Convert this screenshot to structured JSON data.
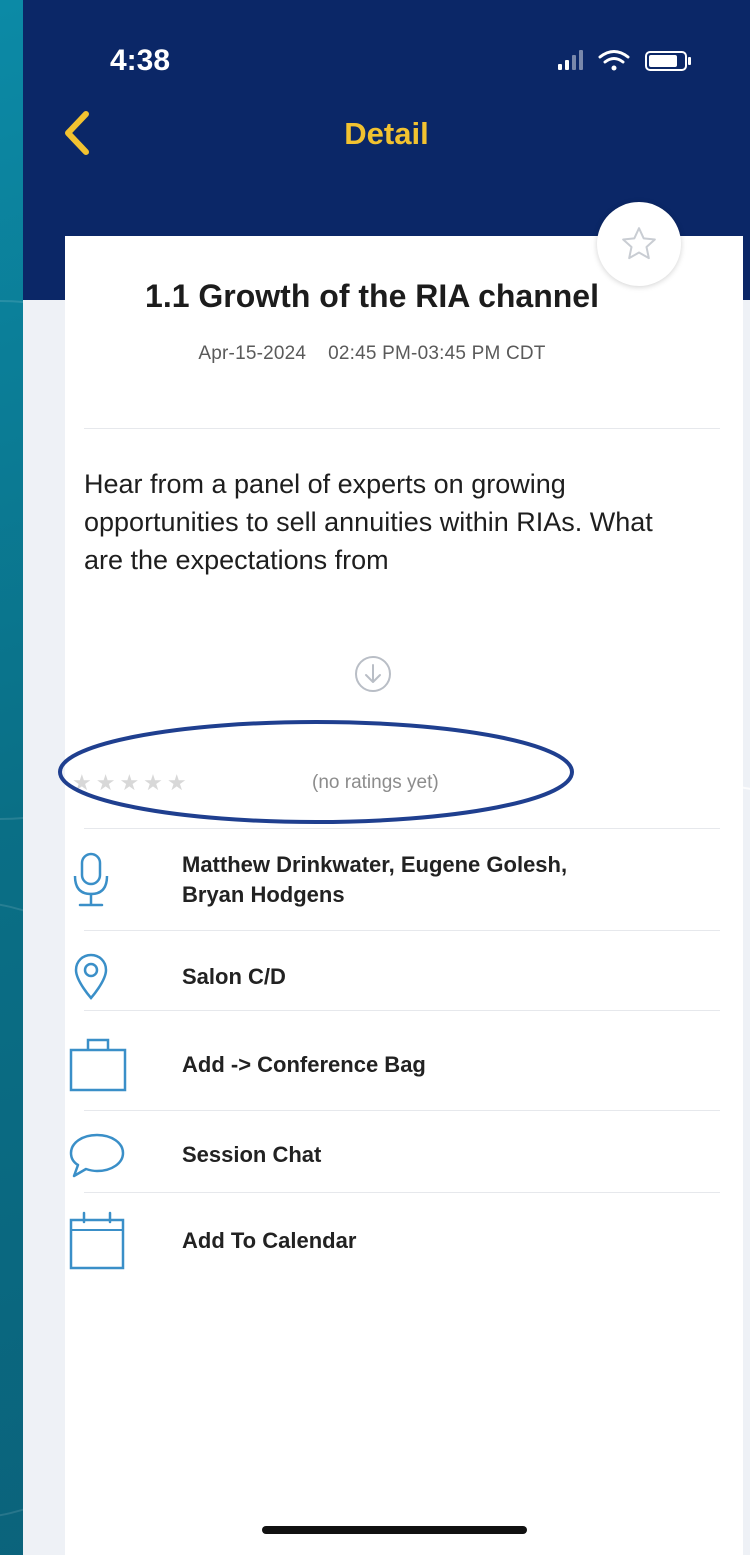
{
  "status_bar": {
    "time": "4:38",
    "icons": [
      "signal-icon",
      "wifi-icon",
      "battery-icon"
    ]
  },
  "nav": {
    "back_icon": "chevron-left-icon",
    "title": "Detail"
  },
  "colors": {
    "navbar": "#0b2767",
    "title_accent": "#f2c230",
    "icon_accent": "#3a8fc8",
    "annotation": "#1f3f8f"
  },
  "session": {
    "title": "1.1 Growth of the RIA channel",
    "datetime": "Apr-15-2024    02:45 PM-03:45 PM CDT",
    "description": "Hear from a panel of experts on growing opportunities to sell annuities within RIAs. What are the expectations from",
    "favorite_icon": "star-outline-icon",
    "expand_icon": "arrow-down-circle-icon"
  },
  "rating": {
    "stars": "★★★★★",
    "value": 0,
    "max": 5,
    "label": "(no ratings yet)"
  },
  "details": [
    {
      "icon": "microphone-icon",
      "label": "Matthew Drinkwater, Eugene Golesh, Bryan Hodgens"
    },
    {
      "icon": "location-pin-icon",
      "label": "Salon C/D"
    },
    {
      "icon": "bag-icon",
      "label": "Add -> Conference Bag"
    },
    {
      "icon": "chat-bubble-icon",
      "label": "Session Chat"
    },
    {
      "icon": "calendar-icon",
      "label": "Add To Calendar"
    }
  ]
}
